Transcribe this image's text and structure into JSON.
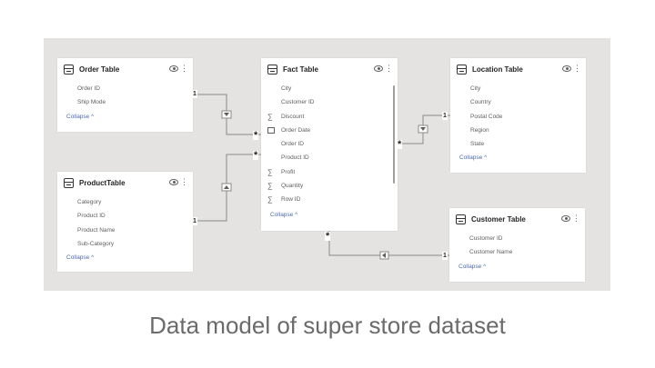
{
  "tables": {
    "order": {
      "title": "Order Table",
      "fields": [
        {
          "label": "Order ID",
          "icon": ""
        },
        {
          "label": "Ship Mode",
          "icon": ""
        }
      ],
      "collapse": "Collapse ^"
    },
    "product": {
      "title": "ProductTable",
      "fields": [
        {
          "label": "Category",
          "icon": ""
        },
        {
          "label": "Product ID",
          "icon": ""
        },
        {
          "label": "Product Name",
          "icon": ""
        },
        {
          "label": "Sub-Category",
          "icon": ""
        }
      ],
      "collapse": "Collapse ^"
    },
    "fact": {
      "title": "Fact Table",
      "fields": [
        {
          "label": "City",
          "icon": ""
        },
        {
          "label": "Customer ID",
          "icon": ""
        },
        {
          "label": "Discount",
          "icon": "sum"
        },
        {
          "label": "Order Date",
          "icon": "calendar"
        },
        {
          "label": "Order ID",
          "icon": ""
        },
        {
          "label": "Product ID",
          "icon": ""
        },
        {
          "label": "Profit",
          "icon": "sum"
        },
        {
          "label": "Quantity",
          "icon": "sum"
        },
        {
          "label": "Row ID",
          "icon": "sum"
        }
      ],
      "collapse": "Collapse ^"
    },
    "location": {
      "title": "Location Table",
      "fields": [
        {
          "label": "City",
          "icon": ""
        },
        {
          "label": "Country",
          "icon": ""
        },
        {
          "label": "Postal Code",
          "icon": ""
        },
        {
          "label": "Region",
          "icon": ""
        },
        {
          "label": "State",
          "icon": ""
        }
      ],
      "collapse": "Collapse ^"
    },
    "customer": {
      "title": "Customer Table",
      "fields": [
        {
          "label": "Customer ID",
          "icon": ""
        },
        {
          "label": "Customer Name",
          "icon": ""
        }
      ],
      "collapse": "Collapse ^"
    }
  },
  "relationship_markers": {
    "one": "1",
    "many": "*"
  },
  "caption": "Data model of super store dataset",
  "colors": {
    "canvas": "#e5e3e1",
    "card": "#ffffff",
    "line": "#8a8886",
    "collapse_link": "#4f6bb2",
    "caption": "#6b6b6b"
  },
  "icons": {
    "table": "table-icon",
    "visibility": "eye-icon",
    "more": "more-icon",
    "measure": "sigma-icon",
    "date": "calendar-icon"
  }
}
